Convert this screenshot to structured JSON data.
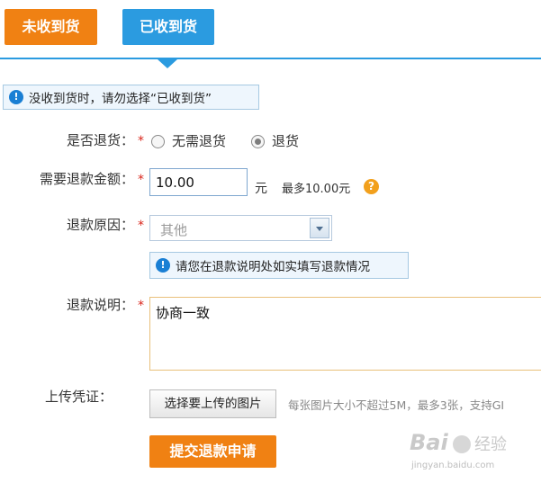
{
  "tabs": {
    "unreceived": "未收到货",
    "received": "已收到货"
  },
  "notice_top": "没收到货时，请勿选择“已收到货”",
  "form": {
    "return_label": "是否退货：",
    "required_mark": "*",
    "return_options": {
      "no_return": "无需退货",
      "return": "退货",
      "selected": "退货"
    },
    "amount_label": "需要退款金额：",
    "amount_value": "10.00",
    "amount_unit": "元",
    "amount_max": "最多10.00元",
    "reason_label": "退款原因：",
    "reason_value": "其他",
    "reason_notice": "请您在退款说明处如实填写退款情况",
    "desc_label": "退款说明：",
    "desc_value": "协商一致",
    "upload_label": "上传凭证：",
    "upload_button": "选择要上传的图片",
    "upload_tip": "每张图片大小不超过5M，最多3张，支持GI",
    "submit_button": "提交退款申请"
  },
  "watermark": {
    "brand": "Bai",
    "brand_cn": "经验",
    "url": "jingyan.baidu.com"
  },
  "colors": {
    "orange": "#f08113",
    "blue": "#2b9be0",
    "required": "#d9261c"
  }
}
